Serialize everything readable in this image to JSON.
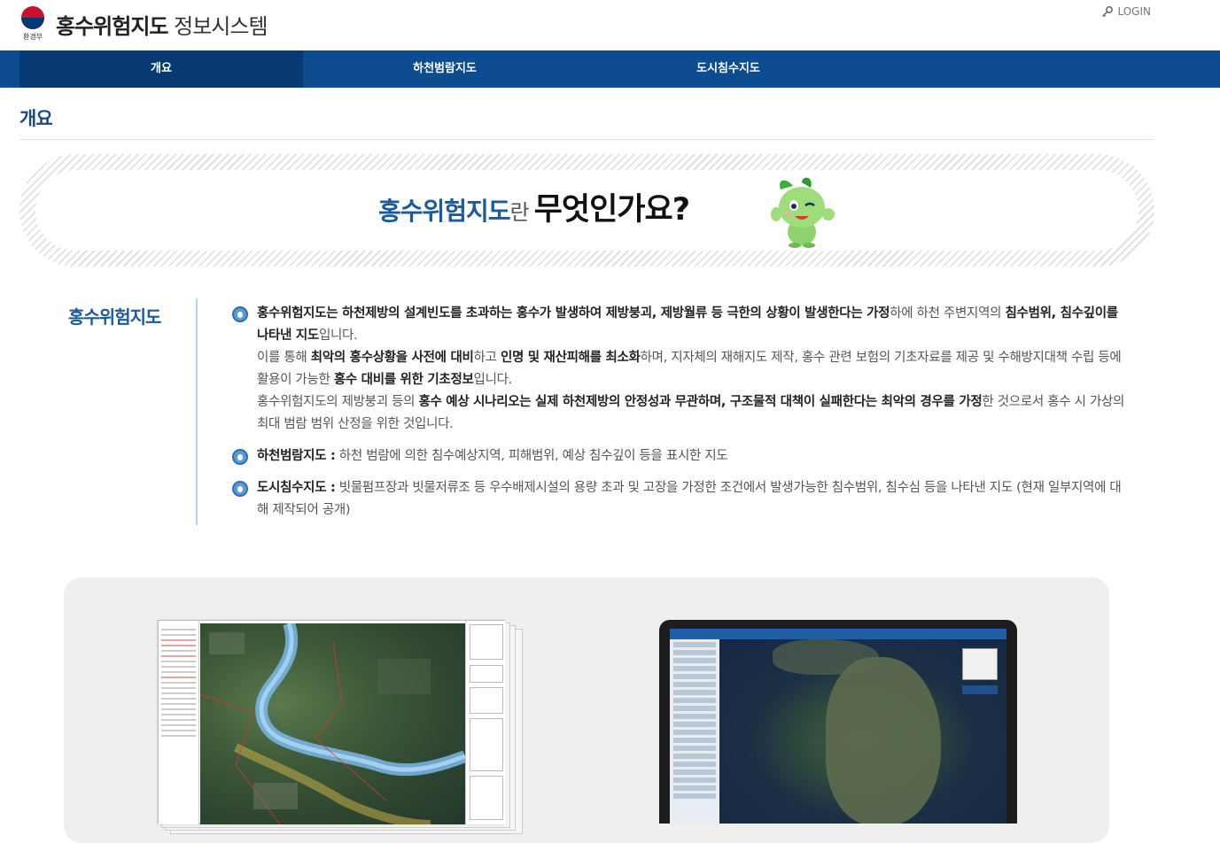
{
  "header": {
    "ministry": "환경부",
    "title_bold": "홍수위험지도",
    "title_light": "정보시스템",
    "login": "LOGIN"
  },
  "nav": {
    "items": [
      {
        "label": "개요"
      },
      {
        "label": "하천범람지도"
      },
      {
        "label": "도시침수지도"
      }
    ]
  },
  "page": {
    "title": "개요"
  },
  "banner": {
    "part1": "홍수위험지도",
    "part2": "란",
    "part3": "무엇인가요?"
  },
  "section": {
    "label": "홍수위험지도",
    "bullet1": {
      "s1": "홍수위험지도는 하천제방의 설계빈도를 초과하는 홍수가 발생하여 제방붕괴, 제방월류 등 극한의 상황이 발생한다는 가정",
      "s2": "하에 하천 주변지역의 ",
      "s3": "침수범위, 침수깊이를 나타낸 지도",
      "s4": "입니다.",
      "s5": "이를 통해 ",
      "s6": "최악의 홍수상황을 사전에 대비",
      "s7": "하고 ",
      "s8": "인명 및 재산피해를 최소화",
      "s9": "하며, 지자체의 재해지도 제작, 홍수 관련 보험의 기초자료를 제공 및 수해방지대책 수립 등에 활용이 가능한 ",
      "s10": "홍수 대비를 위한 기초정보",
      "s11": "입니다.",
      "s12": "홍수위험지도의 제방붕괴 등의 ",
      "s13": "홍수 예상 시나리오는 실제 하천제방의 안정성과 무관하며, 구조물적 대책이 실패한다는 최악의 경우를 가정",
      "s14": "한 것으로서 홍수 시 가상의 최대 범람 범위 산정을 위한 것입니다."
    },
    "bullet2": {
      "term": "하천범람지도 :",
      "desc": " 하천 범람에 의한 침수예상지역, 피해범위, 예상 침수깊이 등을 표시한 지도"
    },
    "bullet3": {
      "term": "도시침수지도 :",
      "desc": " 빗물펌프장과 빗물저류조 등 우수배제시설의 용량 초과 및 고장을 가정한 조건에서 발생가능한 침수범위, 침수심 등을 나타낸 지도 (현재 일부지역에 대해 제작되어 공개)"
    }
  },
  "icons": {
    "login": "key-icon",
    "bullet": "water-drop-icon",
    "mascot": "mascot-character"
  },
  "colors": {
    "nav_bg": "#0d4c8f",
    "nav_active": "#073a73",
    "accent": "#1a5aa0"
  }
}
